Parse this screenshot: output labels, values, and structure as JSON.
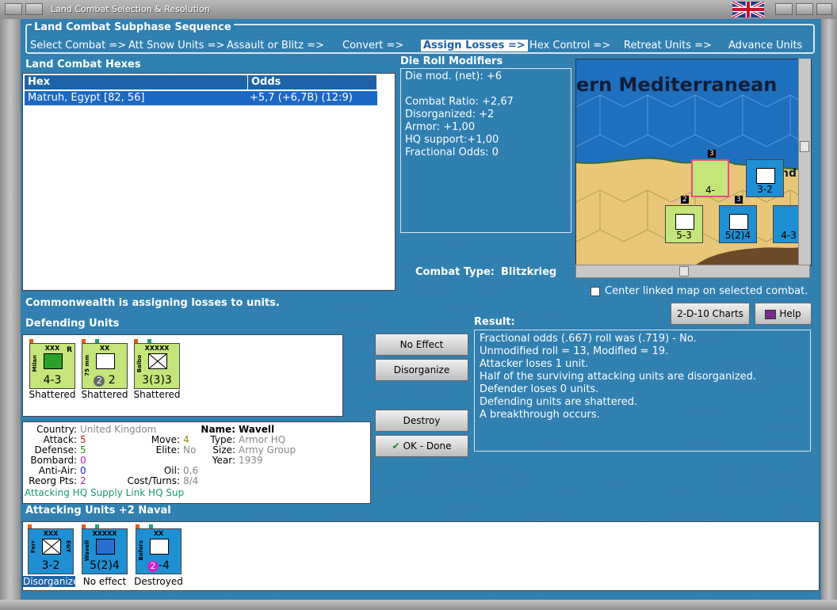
{
  "window": {
    "title": "Land Combat Selection & Resolution"
  },
  "phases": {
    "title": "Land Combat Subphase Sequence",
    "items": [
      "Select Combat =>",
      "Att Snow Units =>",
      "Assault or Blitz =>",
      "Convert =>",
      "Assign Losses =>",
      "Hex Control =>",
      "Retreat Units =>",
      "Advance Units"
    ]
  },
  "hexes": {
    "title": "Land Combat Hexes",
    "col_hex": "Hex",
    "col_odds": "Odds",
    "row_hex": "Matruh, Egypt [82, 56]",
    "row_odds": "+5,7 (+6,7B) (12:9)"
  },
  "die": {
    "title": "Die Roll Modifiers",
    "lines": [
      "Die mod. (net): +6",
      "",
      "Combat Ratio: +2,67",
      "Disorganized: +2",
      "Armor: +1,00",
      "HQ support:+1,00",
      "Fractional Odds: 0"
    ]
  },
  "map": {
    "label": "ern Mediterranean",
    "label2": "nd"
  },
  "combat_type": {
    "label": "Combat Type:",
    "value": "Blitzkrieg"
  },
  "center_map": "Center linked map on selected combat.",
  "status_line": "Commonwealth is assigning losses to units.",
  "charts_btn": "2-D-10 Charts",
  "help_btn": "Help",
  "result": {
    "title": "Result:",
    "lines": [
      "Fractional odds (.667) roll was (.719)  - No.",
      "Unmodified roll = 13, Modified = 19.",
      "Attacker loses 1 unit.",
      "Half of the surviving attacking units are disorganized.",
      "Defender loses 0 units.",
      "Defending units are shattered.",
      "A breakthrough occurs."
    ]
  },
  "buttons": {
    "no_effect": "No Effect",
    "disorganize": "Disorganize",
    "destroy": "Destroy",
    "ok": "OK - Done"
  },
  "defending": {
    "title": "Defending Units",
    "units": [
      {
        "size": "XXX",
        "name": "Milan",
        "strength": "4-3",
        "status": "Shattered",
        "corner": "R"
      },
      {
        "size": "XX",
        "name": "75 mm",
        "strength": "2",
        "badge": "2",
        "status": "Shattered"
      },
      {
        "size": "XXXXX",
        "name": "Balbo",
        "strength": "3(3)3",
        "status": "Shattered"
      }
    ]
  },
  "info": {
    "country_k": "Country:",
    "country_v": "United Kingdom",
    "attack_k": "Attack:",
    "attack_v": "5",
    "defense_k": "Defense:",
    "defense_v": "5",
    "bombard_k": "Bombard:",
    "bombard_v": "0",
    "antiair_k": "Anti-Air:",
    "antiair_v": "0",
    "reorg_k": "Reorg Pts:",
    "reorg_v": "2",
    "move_k": "Move:",
    "move_v": "4",
    "elite_k": "Elite:",
    "elite_v": "No",
    "oil_k": "Oil:",
    "oil_v": "0,6",
    "cost_k": "Cost/Turns:",
    "cost_v": "8/4",
    "name_k": "Name:",
    "name_v": "Wavell",
    "type_k": "Type:",
    "type_v": "Armor HQ",
    "size_k": "Size:",
    "size_v": "Army Group",
    "year_k": "Year:",
    "year_v": "1939",
    "footer": "Attacking HQ Supply Link HQ Sup"
  },
  "attacking": {
    "title": "Attacking Units +2 Naval",
    "units": [
      {
        "size": "XXX",
        "name": "Ferr",
        "side": "EGY",
        "strength": "3-2",
        "status": "Disorganized"
      },
      {
        "size": "XXXXX",
        "name": "Wavell",
        "strength": "5(2)4",
        "status": "No effect"
      },
      {
        "size": "XX",
        "name": "Bofors",
        "strength": "4",
        "badge": "2",
        "status": "Destroyed"
      }
    ]
  },
  "map_units": [
    {
      "strength": "4-",
      "top": "3"
    },
    {
      "strength": "3-2"
    },
    {
      "strength": "5-3",
      "top": "2"
    },
    {
      "strength": "5(2)4",
      "top": "3"
    },
    {
      "strength": "4-3"
    }
  ],
  "colors": {
    "panel": "#2f7fb0",
    "header": "#1d63a8",
    "select": "#1b68c4",
    "green_counter": "#c4e57a",
    "blue_counter": "#1e8fd2"
  }
}
